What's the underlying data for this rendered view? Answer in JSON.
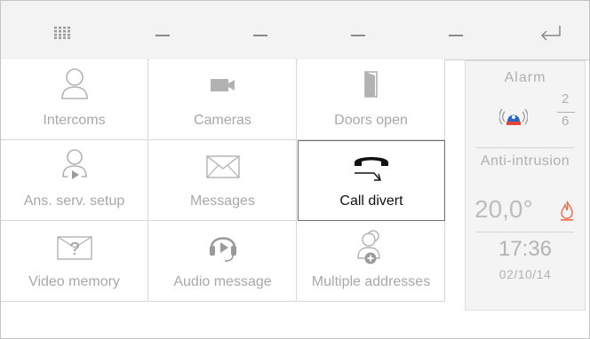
{
  "colors": {
    "topbar_bg": "#f3f3f3",
    "icon_gray": "#b2b2b2",
    "active_text": "#111111",
    "alarm_blue": "#2a67c9",
    "alarm_red": "#e3463a",
    "flame_orange": "#ef6b4a"
  },
  "topbar": {
    "icons": [
      "grid-icon",
      "dash-icon",
      "dash-icon",
      "dash-icon",
      "dash-icon",
      "back-arrow-icon"
    ]
  },
  "tiles": [
    {
      "label": "Intercoms",
      "icon": "person-icon"
    },
    {
      "label": "Cameras",
      "icon": "camera-icon"
    },
    {
      "label": "Doors open",
      "icon": "door-icon"
    },
    {
      "label": "Ans. serv. setup",
      "icon": "answering-service-icon"
    },
    {
      "label": "Messages",
      "icon": "envelope-icon"
    },
    {
      "label": "Call divert",
      "icon": "call-divert-icon",
      "active": true
    },
    {
      "label": "Video memory",
      "icon": "video-memory-icon"
    },
    {
      "label": "Audio message",
      "icon": "audio-message-icon"
    },
    {
      "label": "Multiple addresses",
      "icon": "multiple-addresses-icon"
    }
  ],
  "side": {
    "alarm_title": "Alarm",
    "alarm_numerator": "2",
    "alarm_denominator": "6",
    "anti_intrusion": "Anti-intrusion",
    "temperature": "20,0°",
    "time": "17:36",
    "date": "02/10/14"
  }
}
